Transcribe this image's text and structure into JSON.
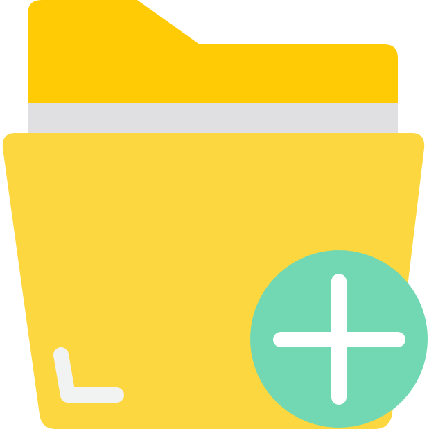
{
  "icon": {
    "name": "add-folder-icon",
    "colors": {
      "folder_back": "#FFCB05",
      "paper": "#E0E0E2",
      "folder_front": "#FDD73F",
      "corner_mark": "#F1F2F2",
      "badge": "#72D8B3",
      "plus": "#FFFFFF"
    }
  }
}
